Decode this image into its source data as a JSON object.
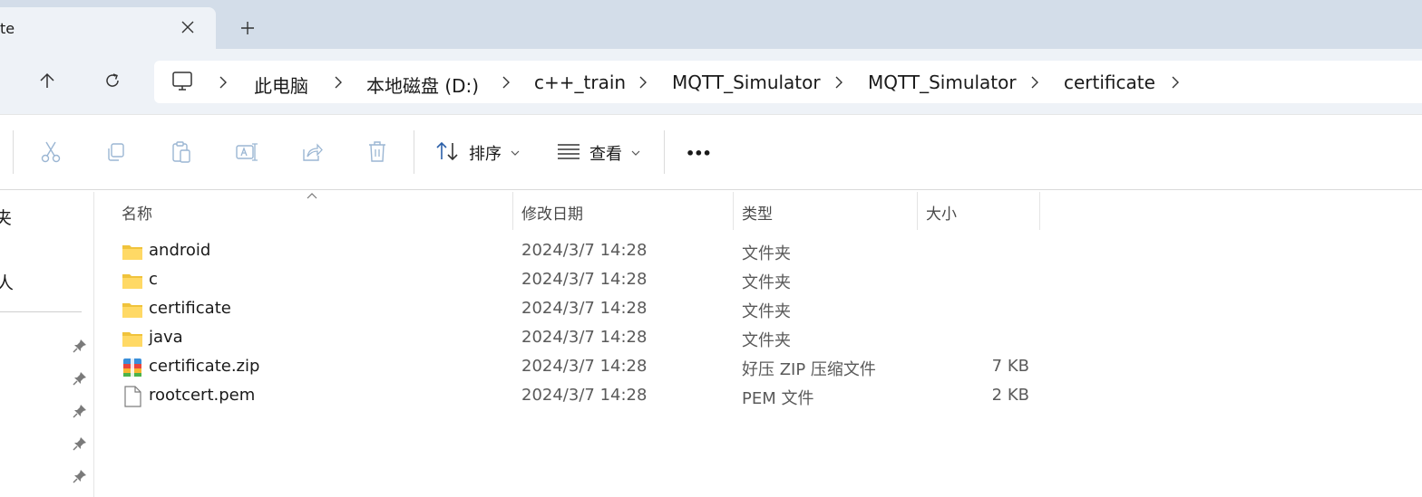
{
  "tab": {
    "title": "te",
    "close_icon": "close-icon",
    "new_tab_icon": "plus-icon"
  },
  "nav": {
    "up_icon": "arrow-up-icon",
    "refresh_icon": "refresh-icon"
  },
  "breadcrumbs": [
    "此电脑",
    "本地磁盘 (D:)",
    "c++_train",
    "MQTT_Simulator",
    "MQTT_Simulator",
    "certificate"
  ],
  "toolbar": {
    "sort_label": "排序",
    "view_label": "查看",
    "more_label": "•••"
  },
  "sidebar": {
    "items": [
      "夹",
      "人"
    ]
  },
  "columns": {
    "name": "名称",
    "date": "修改日期",
    "type": "类型",
    "size": "大小"
  },
  "files": [
    {
      "name": "android",
      "date": "2024/3/7 14:28",
      "type": "文件夹",
      "size": "",
      "icon": "folder-icon"
    },
    {
      "name": "c",
      "date": "2024/3/7 14:28",
      "type": "文件夹",
      "size": "",
      "icon": "folder-icon"
    },
    {
      "name": "certificate",
      "date": "2024/3/7 14:28",
      "type": "文件夹",
      "size": "",
      "icon": "folder-icon"
    },
    {
      "name": "java",
      "date": "2024/3/7 14:28",
      "type": "文件夹",
      "size": "",
      "icon": "folder-icon"
    },
    {
      "name": "certificate.zip",
      "date": "2024/3/7 14:28",
      "type": "好压 ZIP 压缩文件",
      "size": "7 KB",
      "icon": "zip-archive-icon"
    },
    {
      "name": "rootcert.pem",
      "date": "2024/3/7 14:28",
      "type": "PEM 文件",
      "size": "2 KB",
      "icon": "file-icon"
    }
  ]
}
